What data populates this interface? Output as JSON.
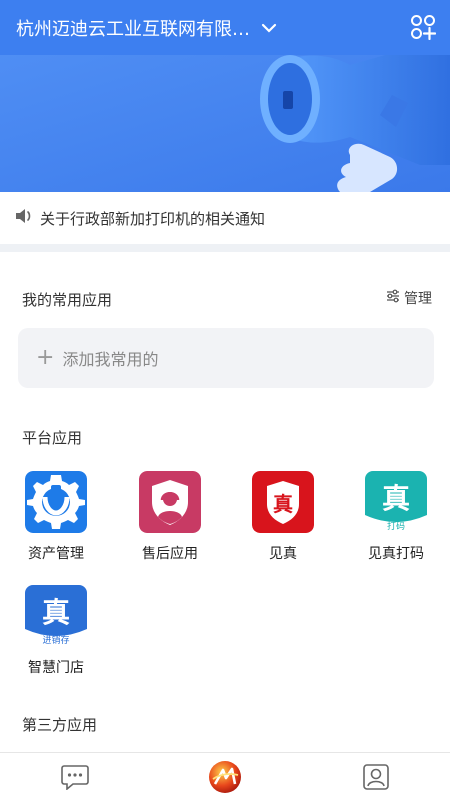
{
  "header": {
    "org_title": "杭州迈迪云工业互联网有限…",
    "icons": {
      "dropdown": "chevron-down-icon",
      "add_app": "grid-add-icon"
    }
  },
  "banner": {
    "icon": "megaphone-illustration"
  },
  "notice": {
    "icon": "speaker-icon",
    "text": "关于行政部新加打印机的相关通知"
  },
  "common_apps": {
    "title": "我的常用应用",
    "manage_label": "管理",
    "add_plus": "+",
    "add_label": "添加我常用的"
  },
  "platform_apps": {
    "title": "平台应用",
    "items": [
      {
        "label": "资产管理",
        "icon": "wrench-gear-icon",
        "color": "#1e7be8"
      },
      {
        "label": "售后应用",
        "icon": "support-agent-icon",
        "color": "#c83a64"
      },
      {
        "label": "见真",
        "icon": "zhen-shield-icon",
        "color": "#d8141c",
        "glyph": "真"
      },
      {
        "label": "见真打码",
        "icon": "zhen-print-icon",
        "color": "#1bb3b0",
        "glyph": "真",
        "sub": "打码"
      },
      {
        "label": "智慧门店",
        "icon": "zhen-store-icon",
        "color": "#2a6fd6",
        "glyph": "真",
        "sub": "进销存"
      }
    ]
  },
  "third_party_apps": {
    "title": "第三方应用"
  },
  "tabbar": {
    "tabs": [
      {
        "icon": "chat-bubble-icon"
      },
      {
        "icon": "brand-logo-icon"
      },
      {
        "icon": "contacts-icon"
      }
    ]
  },
  "colors": {
    "accent": "#3d7ff0",
    "banner": "#4e8cf3",
    "divider": "#eef1f5"
  }
}
